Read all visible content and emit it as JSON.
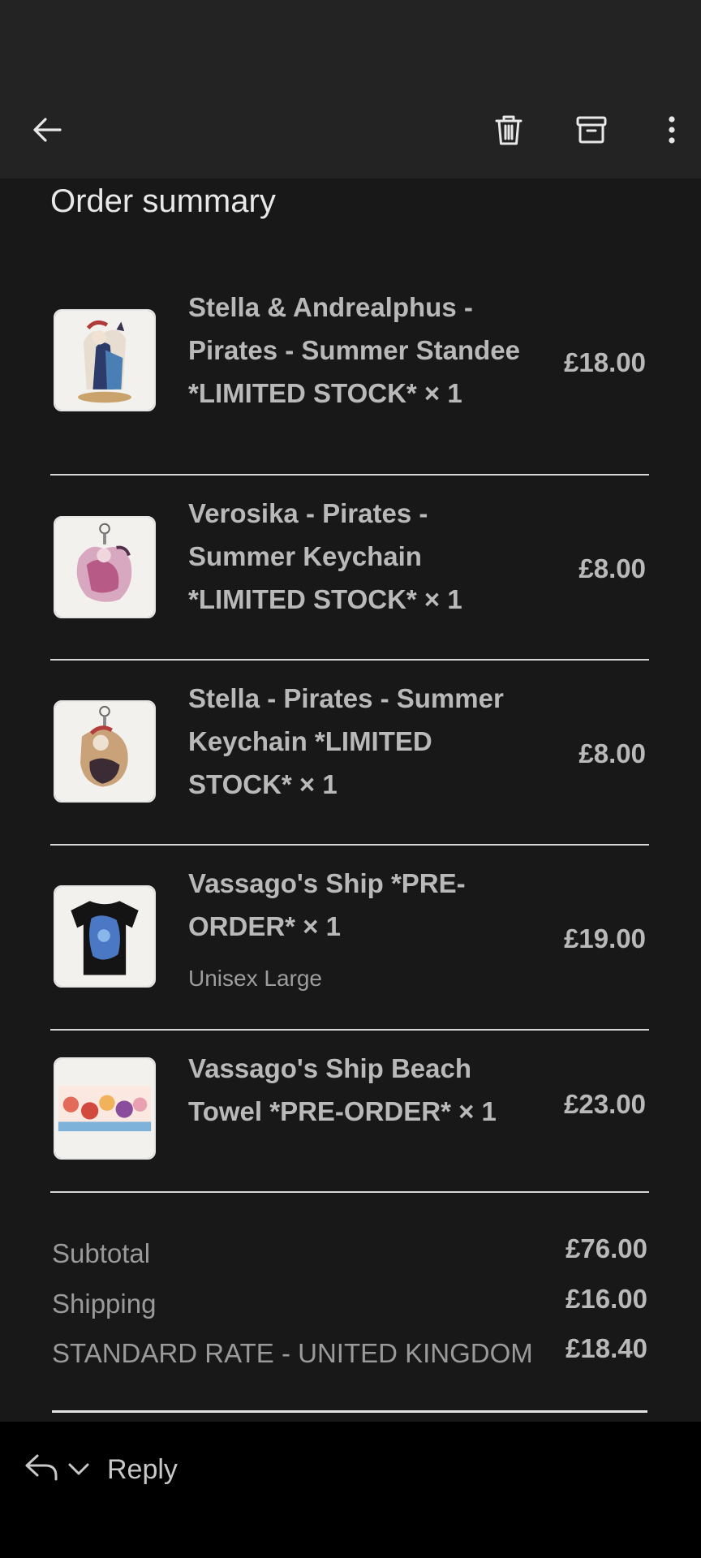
{
  "toolbar": {
    "back_icon": "arrow-left-icon",
    "delete_icon": "trash-icon",
    "archive_icon": "archive-icon",
    "more_icon": "more-vertical-icon"
  },
  "order": {
    "title": "Order summary",
    "items": [
      {
        "name": "Stella & Andrealphus - Pirates - Summer Standee *LIMITED STOCK* × 1",
        "variant": "",
        "price": "£18.00"
      },
      {
        "name": "Verosika - Pirates - Summer Keychain *LIMITED STOCK* × 1",
        "variant": "",
        "price": "£8.00"
      },
      {
        "name": "Stella - Pirates - Summer Keychain *LIMITED STOCK* × 1",
        "variant": "",
        "price": "£8.00"
      },
      {
        "name": "Vassago's Ship *PRE-ORDER* × 1",
        "variant": "Unisex Large",
        "price": "£19.00"
      },
      {
        "name": "Vassago's Ship Beach Towel *PRE-ORDER* × 1",
        "variant": "",
        "price": "£23.00"
      }
    ],
    "totals": [
      {
        "label": "Subtotal",
        "value": "£76.00"
      },
      {
        "label": "Shipping",
        "value": "£16.00"
      },
      {
        "label": "STANDARD RATE - UNITED KINGDOM",
        "value": "£18.40"
      }
    ]
  },
  "reply": {
    "label": "Reply",
    "reply_icon": "reply-icon",
    "chevron_icon": "chevron-down-icon"
  },
  "colors": {
    "background": "#181818",
    "toolbar": "#232323",
    "reply_bar": "#000000",
    "text": "#b9b9b9"
  }
}
